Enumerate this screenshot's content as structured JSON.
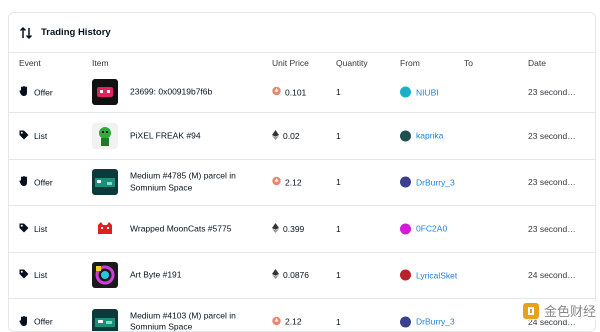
{
  "panel": {
    "title": "Trading History",
    "icon": "sort-arrows-icon"
  },
  "columns": [
    "Event",
    "Item",
    "Unit Price",
    "Quantity",
    "From",
    "To",
    "Date"
  ],
  "rows": [
    {
      "event": "Offer",
      "event_icon": "hand-icon",
      "item": "23699: 0x00919b7f6b",
      "price_icon": "weth-icon",
      "price": "0.101",
      "quantity": "1",
      "from": "NIUBI",
      "from_color": "#1ab0c8",
      "to": "",
      "date": "23 second…"
    },
    {
      "event": "List",
      "event_icon": "tag-icon",
      "item": "PiXEL FREAK #94",
      "price_icon": "eth-icon",
      "price": "0.02",
      "quantity": "1",
      "from": "kaprika",
      "from_color": "#1f4f4f",
      "to": "",
      "date": "23 second…"
    },
    {
      "event": "Offer",
      "event_icon": "hand-icon",
      "item": "Medium #4785 (M) parcel in Somnium Space",
      "price_icon": "weth-icon",
      "price": "2.12",
      "quantity": "1",
      "from": "DrBurry_3",
      "from_color": "#3a3f8f",
      "to": "",
      "date": "23 second…"
    },
    {
      "event": "List",
      "event_icon": "tag-icon",
      "item": "Wrapped MoonCats #5775",
      "price_icon": "eth-icon",
      "price": "0.399",
      "quantity": "1",
      "from": "0FC2A0",
      "from_color": "#d31ad6",
      "to": "",
      "date": "23 second…"
    },
    {
      "event": "List",
      "event_icon": "tag-icon",
      "item": "Art Byte #191",
      "price_icon": "eth-icon",
      "price": "0.0876",
      "quantity": "1",
      "from": "LyricalSket",
      "from_color": "#b5242b",
      "to": "",
      "date": "24 second…"
    },
    {
      "event": "Offer",
      "event_icon": "hand-icon",
      "item": "Medium #4103 (M) parcel in Somnium Space",
      "price_icon": "weth-icon",
      "price": "2.12",
      "quantity": "1",
      "from": "DrBurry_3",
      "from_color": "#3a3f8f",
      "to": "",
      "date": "24 second…"
    }
  ],
  "watermark": {
    "text": "金色财经"
  }
}
